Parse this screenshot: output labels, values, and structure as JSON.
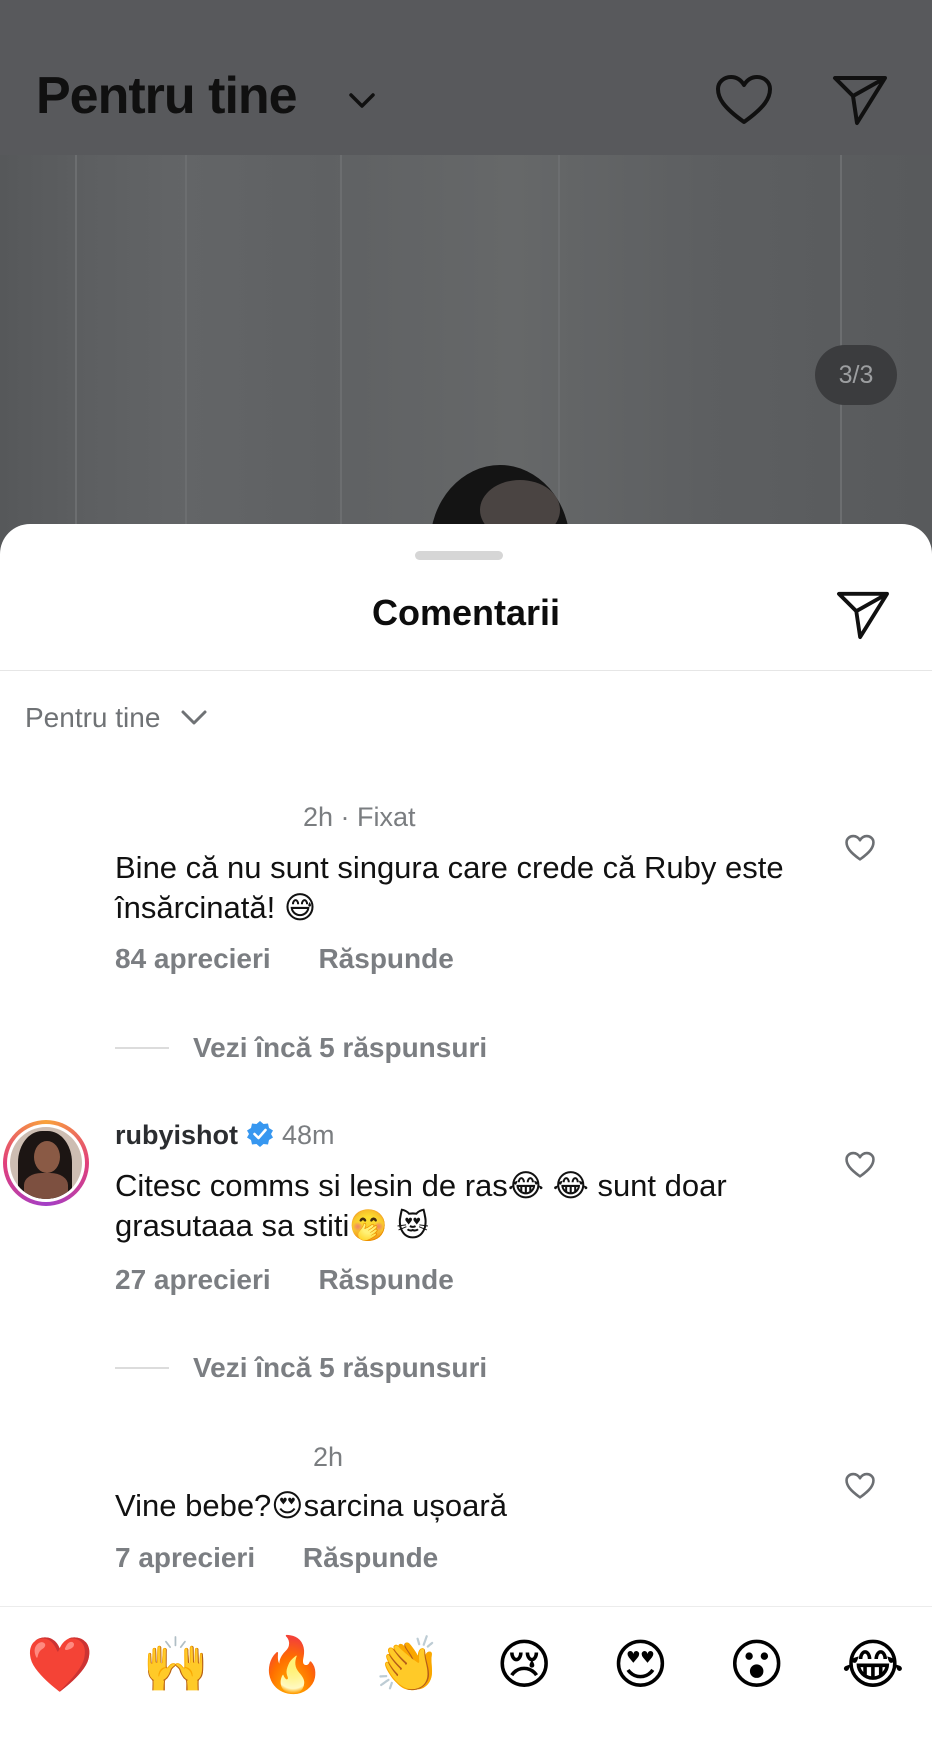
{
  "header": {
    "title": "Pentru tine"
  },
  "post": {
    "counter": "3/3"
  },
  "sheet": {
    "title": "Comentarii"
  },
  "sort": {
    "label": "Pentru tine"
  },
  "comments": [
    {
      "username": "",
      "time": "2h · Fixat",
      "text": "Bine că nu sunt singura care crede că Ruby este însărcinată! 😅",
      "likes": "84 aprecieri",
      "reply": "Răspunde",
      "view_replies": "Vezi încă 5 răspunsuri"
    },
    {
      "username": "rubyishot",
      "verified": true,
      "time": "48m",
      "text": "Citesc comms si lesin de ras😂 😂 sunt doar grasutaaa sa stiti🤭 😻",
      "likes": "27 aprecieri",
      "reply": "Răspunde",
      "view_replies": "Vezi încă 5 răspunsuri"
    },
    {
      "username": "",
      "time": "2h",
      "text": "Vine bebe?😍sarcina ușoară",
      "likes": "7 aprecieri",
      "reply": "Răspunde"
    }
  ],
  "quick_reactions": [
    "❤️",
    "🙌",
    "🔥",
    "👏",
    "😢",
    "😍",
    "😮",
    "😂"
  ],
  "colors": {
    "verified": "#3797f0",
    "sheet_bg": "#ffffff",
    "overlay": "#58595c"
  }
}
